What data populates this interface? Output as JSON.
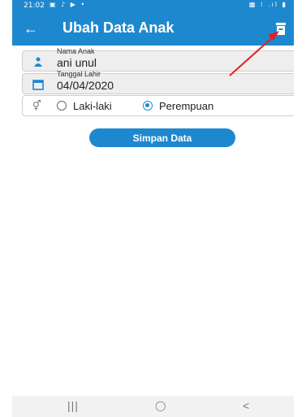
{
  "status_bar": {
    "time": "21:02",
    "left_icons": "▣ ♪ ▶ •",
    "right_icons": "▩ ⁞ .ıl ▮"
  },
  "app_bar": {
    "title": "Ubah Data Anak",
    "back_icon": "arrow-left-icon",
    "delete_icon": "trash-icon"
  },
  "form": {
    "name_field": {
      "label": "Nama Anak",
      "value": "ani unul",
      "icon": "child-icon"
    },
    "dob_field": {
      "label": "Tanggal Lahir",
      "value": "04/04/2020",
      "icon": "calendar-icon"
    },
    "gender": {
      "icon": "gender-icon",
      "options": [
        {
          "label": "Laki-laki",
          "selected": false
        },
        {
          "label": "Perempuan",
          "selected": true
        }
      ]
    },
    "save_button": "Simpan Data"
  },
  "nav_bar": {
    "recents": "|||",
    "home": "◯",
    "back": "<"
  },
  "colors": {
    "primary": "#1E88CF",
    "annotation_arrow": "#E02020"
  }
}
